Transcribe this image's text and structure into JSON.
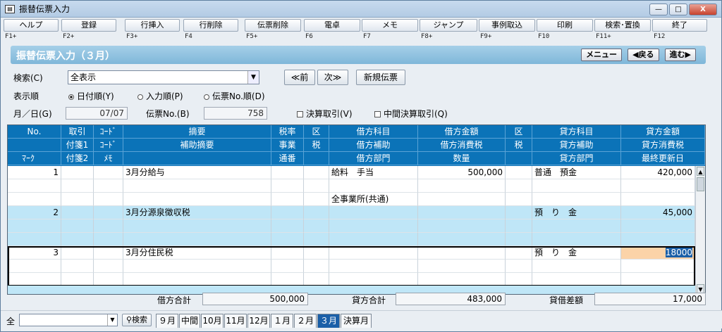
{
  "window": {
    "title": "振替伝票入力",
    "min": "—",
    "max": "□",
    "close": "X"
  },
  "fkeys": [
    {
      "label": "ヘルプ",
      "key": "F1+"
    },
    {
      "label": "登録",
      "key": "F2+"
    },
    {
      "label": "行挿入",
      "key": "F3+"
    },
    {
      "label": "行削除",
      "key": "F4"
    },
    {
      "label": "伝票削除",
      "key": "F5+"
    },
    {
      "label": "電卓",
      "key": "F6"
    },
    {
      "label": "メモ",
      "key": "F7"
    },
    {
      "label": "ジャンプ",
      "key": "F8+"
    },
    {
      "label": "事例取込",
      "key": "F9+"
    },
    {
      "label": "印刷",
      "key": "F10"
    },
    {
      "label": "検索･置換",
      "key": "F11+"
    },
    {
      "label": "終了",
      "key": "F12"
    }
  ],
  "header": {
    "title": "振替伝票入力（３月）",
    "menu": "メニュー",
    "back": "◀戻る",
    "next": "進む▶"
  },
  "search": {
    "label": "検索(C)",
    "value": "全表示",
    "prev": "≪前",
    "next": "次≫",
    "new_button": "新規伝票"
  },
  "order": {
    "label": "表示順",
    "opt1": "日付順(Y)",
    "opt2": "入力順(P)",
    "opt3": "伝票No.順(D)"
  },
  "date": {
    "label": "月／日(G)",
    "value": "07/07",
    "voucher_label": "伝票No.(B)",
    "voucher_value": "758",
    "chk1": "決算取引(V)",
    "chk2": "中間決算取引(Q)"
  },
  "grid_header": {
    "r1": [
      "No.",
      "取引",
      "ｺｰﾄﾞ",
      "摘要",
      "税率",
      "区",
      "借方科目",
      "借方金額",
      "区",
      "貸方科目",
      "貸方金額"
    ],
    "r2": [
      "付箋1",
      "ｺｰﾄﾞ",
      "補助摘要",
      "事業",
      "税",
      "借方補助",
      "借方消費税",
      "税",
      "貸方補助",
      "貸方消費税"
    ],
    "r3": [
      "ﾏｰｸ",
      "付箋2",
      "ﾒﾓ",
      "通番",
      "借方部門",
      "数量",
      "貸方部門",
      "最終更新日"
    ]
  },
  "entries": [
    {
      "no": "1",
      "desc": "3月分給与",
      "debit_acct": "給料　手当",
      "debit_amt": "500,000",
      "credit_acct": "普通　預金",
      "credit_amt": "420,000",
      "dept": "全事業所(共通)"
    },
    {
      "no": "2",
      "desc": "3月分源泉徴収税",
      "debit_acct": "",
      "debit_amt": "",
      "credit_acct": "預　り　金",
      "credit_amt": "45,000",
      "dept": ""
    },
    {
      "no": "3",
      "desc": "3月分住民税",
      "debit_acct": "",
      "debit_amt": "",
      "credit_acct": "預　り　金",
      "credit_amt": "18000",
      "dept": ""
    }
  ],
  "totals": {
    "debit_label": "借方合計",
    "debit_value": "500,000",
    "credit_label": "貸方合計",
    "credit_value": "483,000",
    "diff_label": "貸借差額",
    "diff_value": "17,000"
  },
  "bottom": {
    "scope": "全",
    "search_btn": "検索",
    "months": [
      "９月",
      "中間",
      "10月",
      "11月",
      "12月",
      "１月",
      "２月",
      "３月",
      "決算月"
    ],
    "active_month": "３月"
  }
}
